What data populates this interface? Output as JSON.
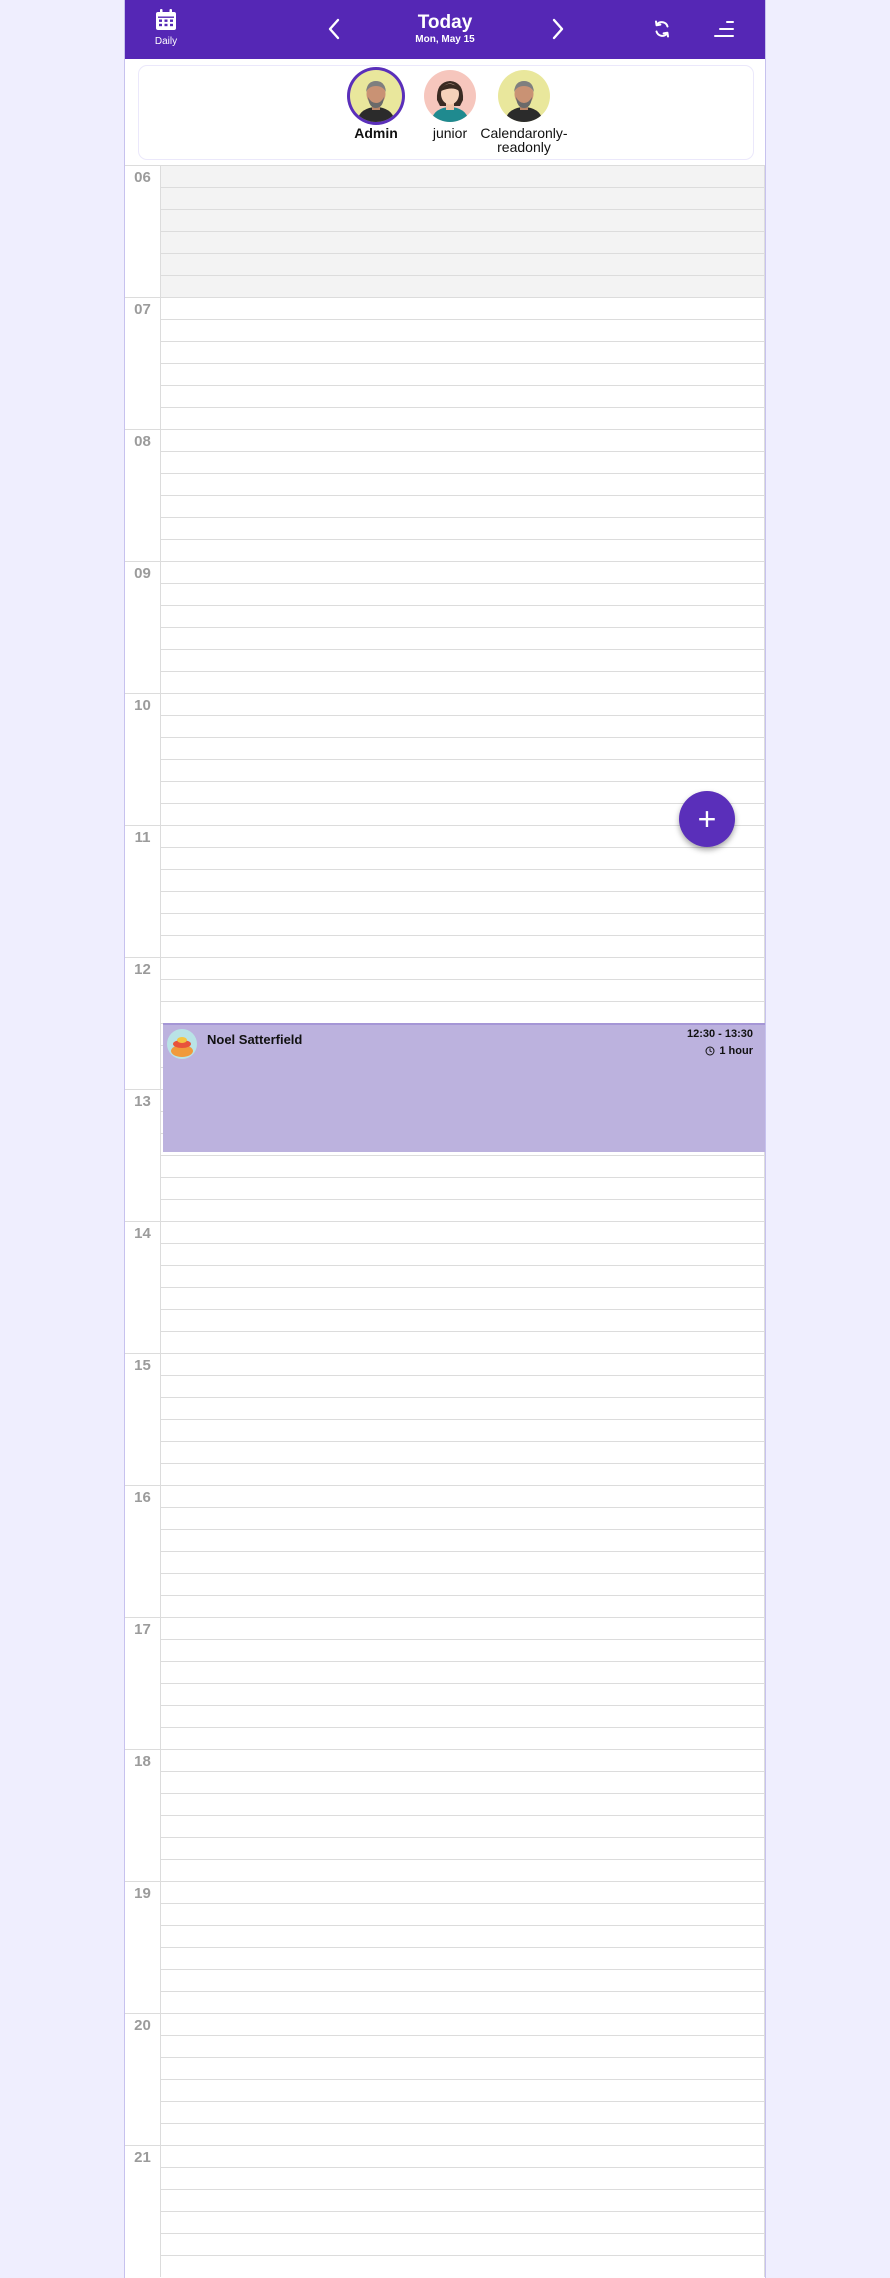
{
  "header": {
    "view_label": "Daily",
    "title": "Today",
    "date": "Mon, May 15",
    "icons": {
      "view": "calendar-icon",
      "prev": "chevron-left-icon",
      "next": "chevron-right-icon",
      "refresh": "refresh-icon",
      "menu": "menu-icon"
    }
  },
  "users": [
    {
      "name": "Admin",
      "selected": true
    },
    {
      "name": "junior",
      "selected": false
    },
    {
      "name": "Calendaronly-readonly",
      "selected": false
    }
  ],
  "hours": [
    "06",
    "07",
    "08",
    "09",
    "10",
    "11",
    "12",
    "13",
    "14",
    "15",
    "16",
    "17",
    "18",
    "19",
    "20",
    "21"
  ],
  "closed_hours": [
    "06"
  ],
  "event": {
    "name": "Noel Satterfield",
    "time": "12:30 - 13:30",
    "duration": "1 hour",
    "start": "12:30",
    "end": "13:30"
  },
  "fab": {
    "label": "+"
  },
  "colors": {
    "primary": "#5527b5",
    "event_bg": "#bcb2de",
    "page_bg": "#efeefe"
  }
}
